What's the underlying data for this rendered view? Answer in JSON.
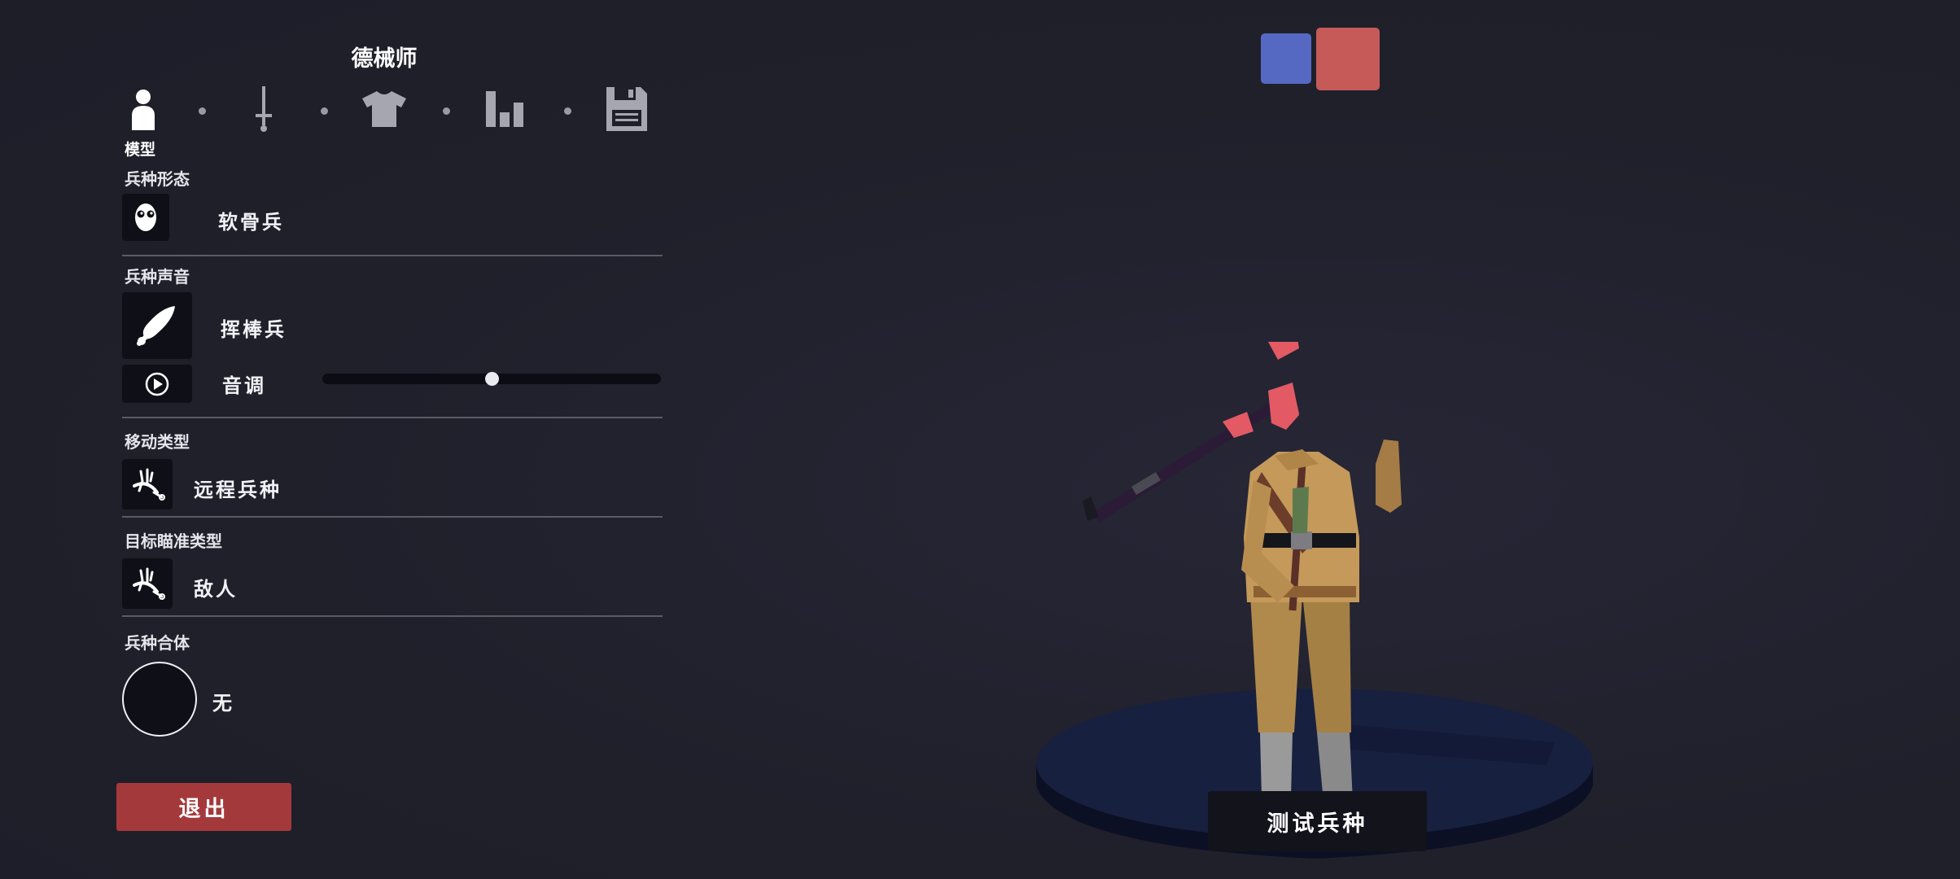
{
  "header": {
    "unit_name": "德械师"
  },
  "tabs": [
    {
      "name": "model",
      "icon": "person-icon",
      "active": true
    },
    {
      "name": "weapons",
      "icon": "sword-icon",
      "active": false
    },
    {
      "name": "clothing",
      "icon": "shirt-icon",
      "active": false
    },
    {
      "name": "stats",
      "icon": "bar-chart-icon",
      "active": false
    },
    {
      "name": "save",
      "icon": "floppy-disk-icon",
      "active": false
    }
  ],
  "active_tab_label": "模型",
  "sections": {
    "unit_form": {
      "label": "兵种形态",
      "value": "软骨兵",
      "icon": "ragdoll-face-icon"
    },
    "unit_voice": {
      "label": "兵种声音",
      "value": "挥棒兵",
      "icon": "club-icon",
      "play_icon": "play-icon"
    },
    "pitch": {
      "label": "音调",
      "level": 0.5
    },
    "movement_type": {
      "label": "移动类型",
      "value": "远程兵种",
      "icon": "ranged-unit-icon"
    },
    "target_type": {
      "label": "目标瞄准类型",
      "value": "敌人",
      "icon": "enemy-target-icon"
    },
    "unit_merge": {
      "label": "兵种合体",
      "value": "无"
    }
  },
  "buttons": {
    "exit": "退出",
    "test_unit": "测试兵种"
  },
  "team_colors": {
    "blue": "#5669c2",
    "red": "#c65a58"
  },
  "colors": {
    "background": "#20202b",
    "exit_button": "#a4393b"
  }
}
